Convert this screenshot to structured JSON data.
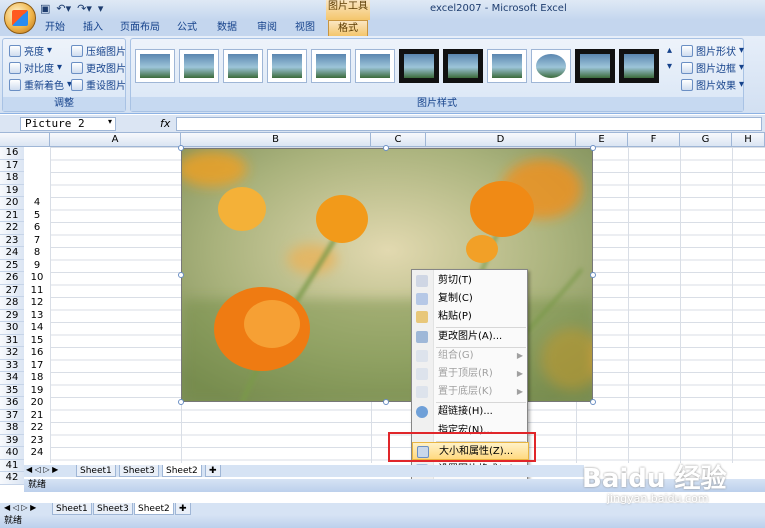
{
  "title_bar": {
    "app_title": "excel2007 - Microsoft Excel",
    "context_tool_title": "图片工具"
  },
  "ribbon_tabs": [
    "开始",
    "插入",
    "页面布局",
    "公式",
    "数据",
    "审阅",
    "视图",
    "格式"
  ],
  "ribbon": {
    "adjust_group": {
      "label": "调整",
      "items": [
        "亮度",
        "压缩图片",
        "对比度",
        "更改图片",
        "重新着色",
        "重设图片"
      ]
    },
    "styles_group": {
      "label": "图片样式"
    },
    "right_group": {
      "items": [
        "图片形状",
        "图片边框",
        "图片效果"
      ]
    }
  },
  "formula_bar": {
    "name_box": "Picture 2",
    "fx": "fx"
  },
  "columns": [
    "A",
    "B",
    "C",
    "D",
    "E",
    "F",
    "G",
    "H"
  ],
  "rows_outer": [
    "16",
    "17",
    "18",
    "19",
    "20",
    "21",
    "22",
    "23",
    "24",
    "25",
    "26",
    "27",
    "28",
    "29",
    "30",
    "31",
    "32",
    "33",
    "34",
    "35",
    "36",
    "37",
    "38",
    "39",
    "40",
    "41",
    "42"
  ],
  "rows_inner": [
    "4",
    "5",
    "6",
    "7",
    "8",
    "9",
    "10",
    "11",
    "12",
    "13",
    "14",
    "15",
    "16",
    "17",
    "18",
    "19",
    "20",
    "21",
    "22",
    "23",
    "24"
  ],
  "context_menu": {
    "items": [
      {
        "label": "剪切(T)",
        "enabled": true
      },
      {
        "label": "复制(C)",
        "enabled": true
      },
      {
        "label": "粘贴(P)",
        "enabled": true
      },
      {
        "label": "更改图片(A)...",
        "enabled": true
      },
      {
        "label": "组合(G)",
        "enabled": false,
        "submenu": true
      },
      {
        "label": "置于顶层(R)",
        "enabled": false,
        "submenu": true
      },
      {
        "label": "置于底层(K)",
        "enabled": false,
        "submenu": true
      },
      {
        "label": "超链接(H)...",
        "enabled": true
      },
      {
        "label": "指定宏(N)...",
        "enabled": true
      },
      {
        "label": "大小和属性(Z)...",
        "enabled": true,
        "highlighted": true
      },
      {
        "label": "设置图片格式(O)...",
        "enabled": true
      }
    ]
  },
  "sheet_tabs_inner": [
    "Sheet1",
    "Sheet3",
    "Sheet2"
  ],
  "sheet_tabs_outer": [
    "Sheet1",
    "Sheet3",
    "Sheet2"
  ],
  "status": {
    "inner": "就绪",
    "outer": "就绪"
  },
  "watermark": {
    "brand": "Baidu 经验",
    "url": "jingyan.baidu.com"
  }
}
